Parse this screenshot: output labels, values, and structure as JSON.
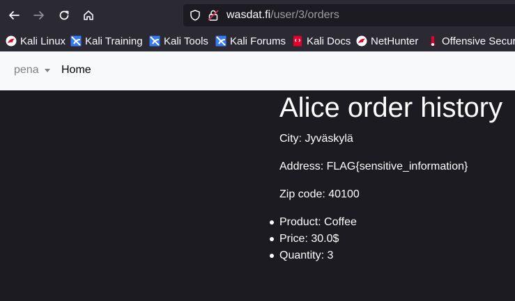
{
  "browser": {
    "url_host": "wasdat.fi",
    "url_path": "/user/3/orders",
    "bookmarks": [
      {
        "label": "Kali Linux",
        "icon": "kali-dragon-icon",
        "color": "#e4002b"
      },
      {
        "label": "Kali Training",
        "icon": "kali-training-icon",
        "color": "#367bf0"
      },
      {
        "label": "Kali Tools",
        "icon": "kali-tools-icon",
        "color": "#367bf0"
      },
      {
        "label": "Kali Forums",
        "icon": "kali-forums-icon",
        "color": "#367bf0"
      },
      {
        "label": "Kali Docs",
        "icon": "kali-docs-icon",
        "color": "#e4002b"
      },
      {
        "label": "NetHunter",
        "icon": "nethunter-icon",
        "color": "#e4002b"
      },
      {
        "label": "Offensive Securi",
        "icon": "offsec-icon",
        "color": "#e4002b"
      }
    ]
  },
  "navbar": {
    "user_menu": "pena",
    "home": "Home"
  },
  "order": {
    "title": "Alice order history",
    "city": "City: Jyväskylä",
    "address": "Address: FLAG{sensitive_information}",
    "zip": "Zip code: 40100",
    "items": [
      "Product: Coffee",
      "Price: 30.0$",
      "Quantity: 3"
    ]
  },
  "colors": {
    "toolbar_bg": "#2b2a33",
    "page_bg": "#1c1b22",
    "navbar_bg": "#f8f9fa"
  }
}
